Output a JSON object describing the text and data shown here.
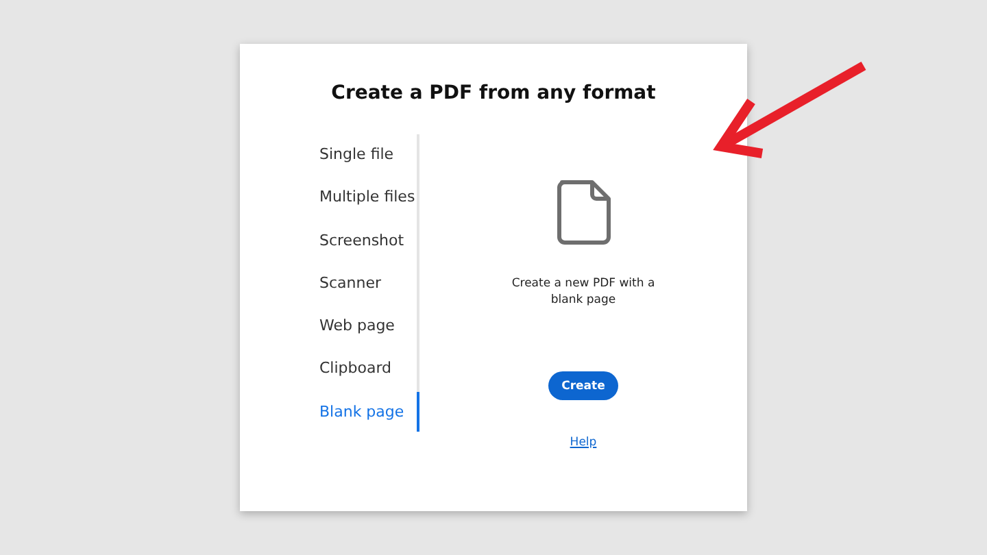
{
  "dialog": {
    "title": "Create a PDF from any format"
  },
  "sidebar": {
    "items": [
      {
        "label": "Single file",
        "selected": false
      },
      {
        "label": "Multiple files",
        "selected": false
      },
      {
        "label": "Screenshot",
        "selected": false
      },
      {
        "label": "Scanner",
        "selected": false
      },
      {
        "label": "Web page",
        "selected": false
      },
      {
        "label": "Clipboard",
        "selected": false
      },
      {
        "label": "Blank page",
        "selected": true
      }
    ]
  },
  "content": {
    "description": "Create a new PDF with a blank page",
    "button": "Create",
    "link": "Help"
  }
}
